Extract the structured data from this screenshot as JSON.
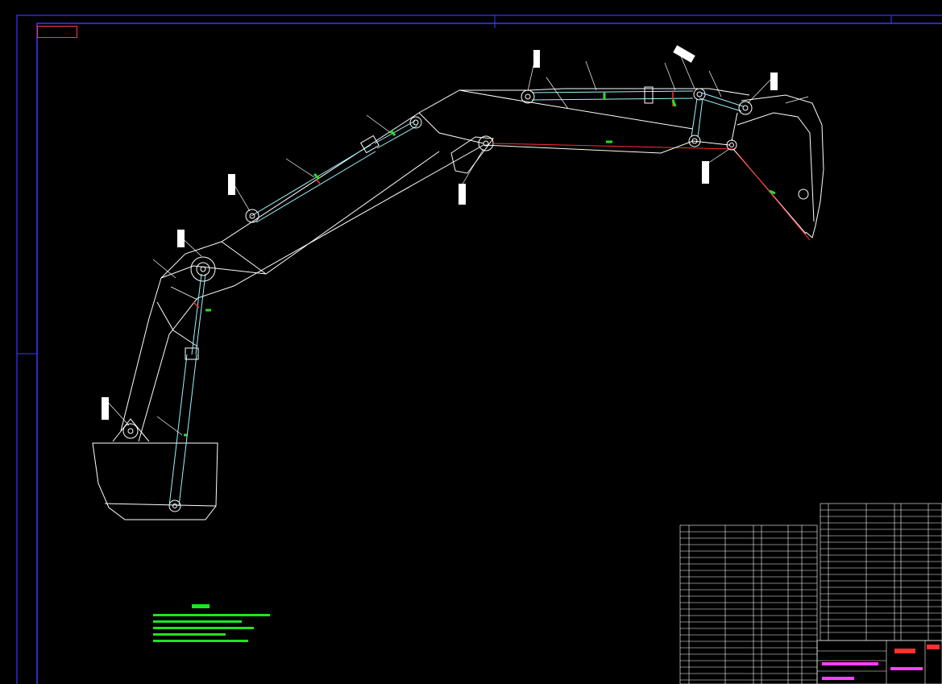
{
  "drawing": {
    "stamp_label": "",
    "colors": {
      "background": "#000000",
      "frame": "#3a3aff",
      "outline": "#ffffff",
      "hydraulic": "#9ff5ff",
      "accent_green": "#2bdc2b",
      "accent_red": "#ff3030",
      "accent_magenta": "#ff40ff",
      "notes": "#1ee61e"
    }
  }
}
